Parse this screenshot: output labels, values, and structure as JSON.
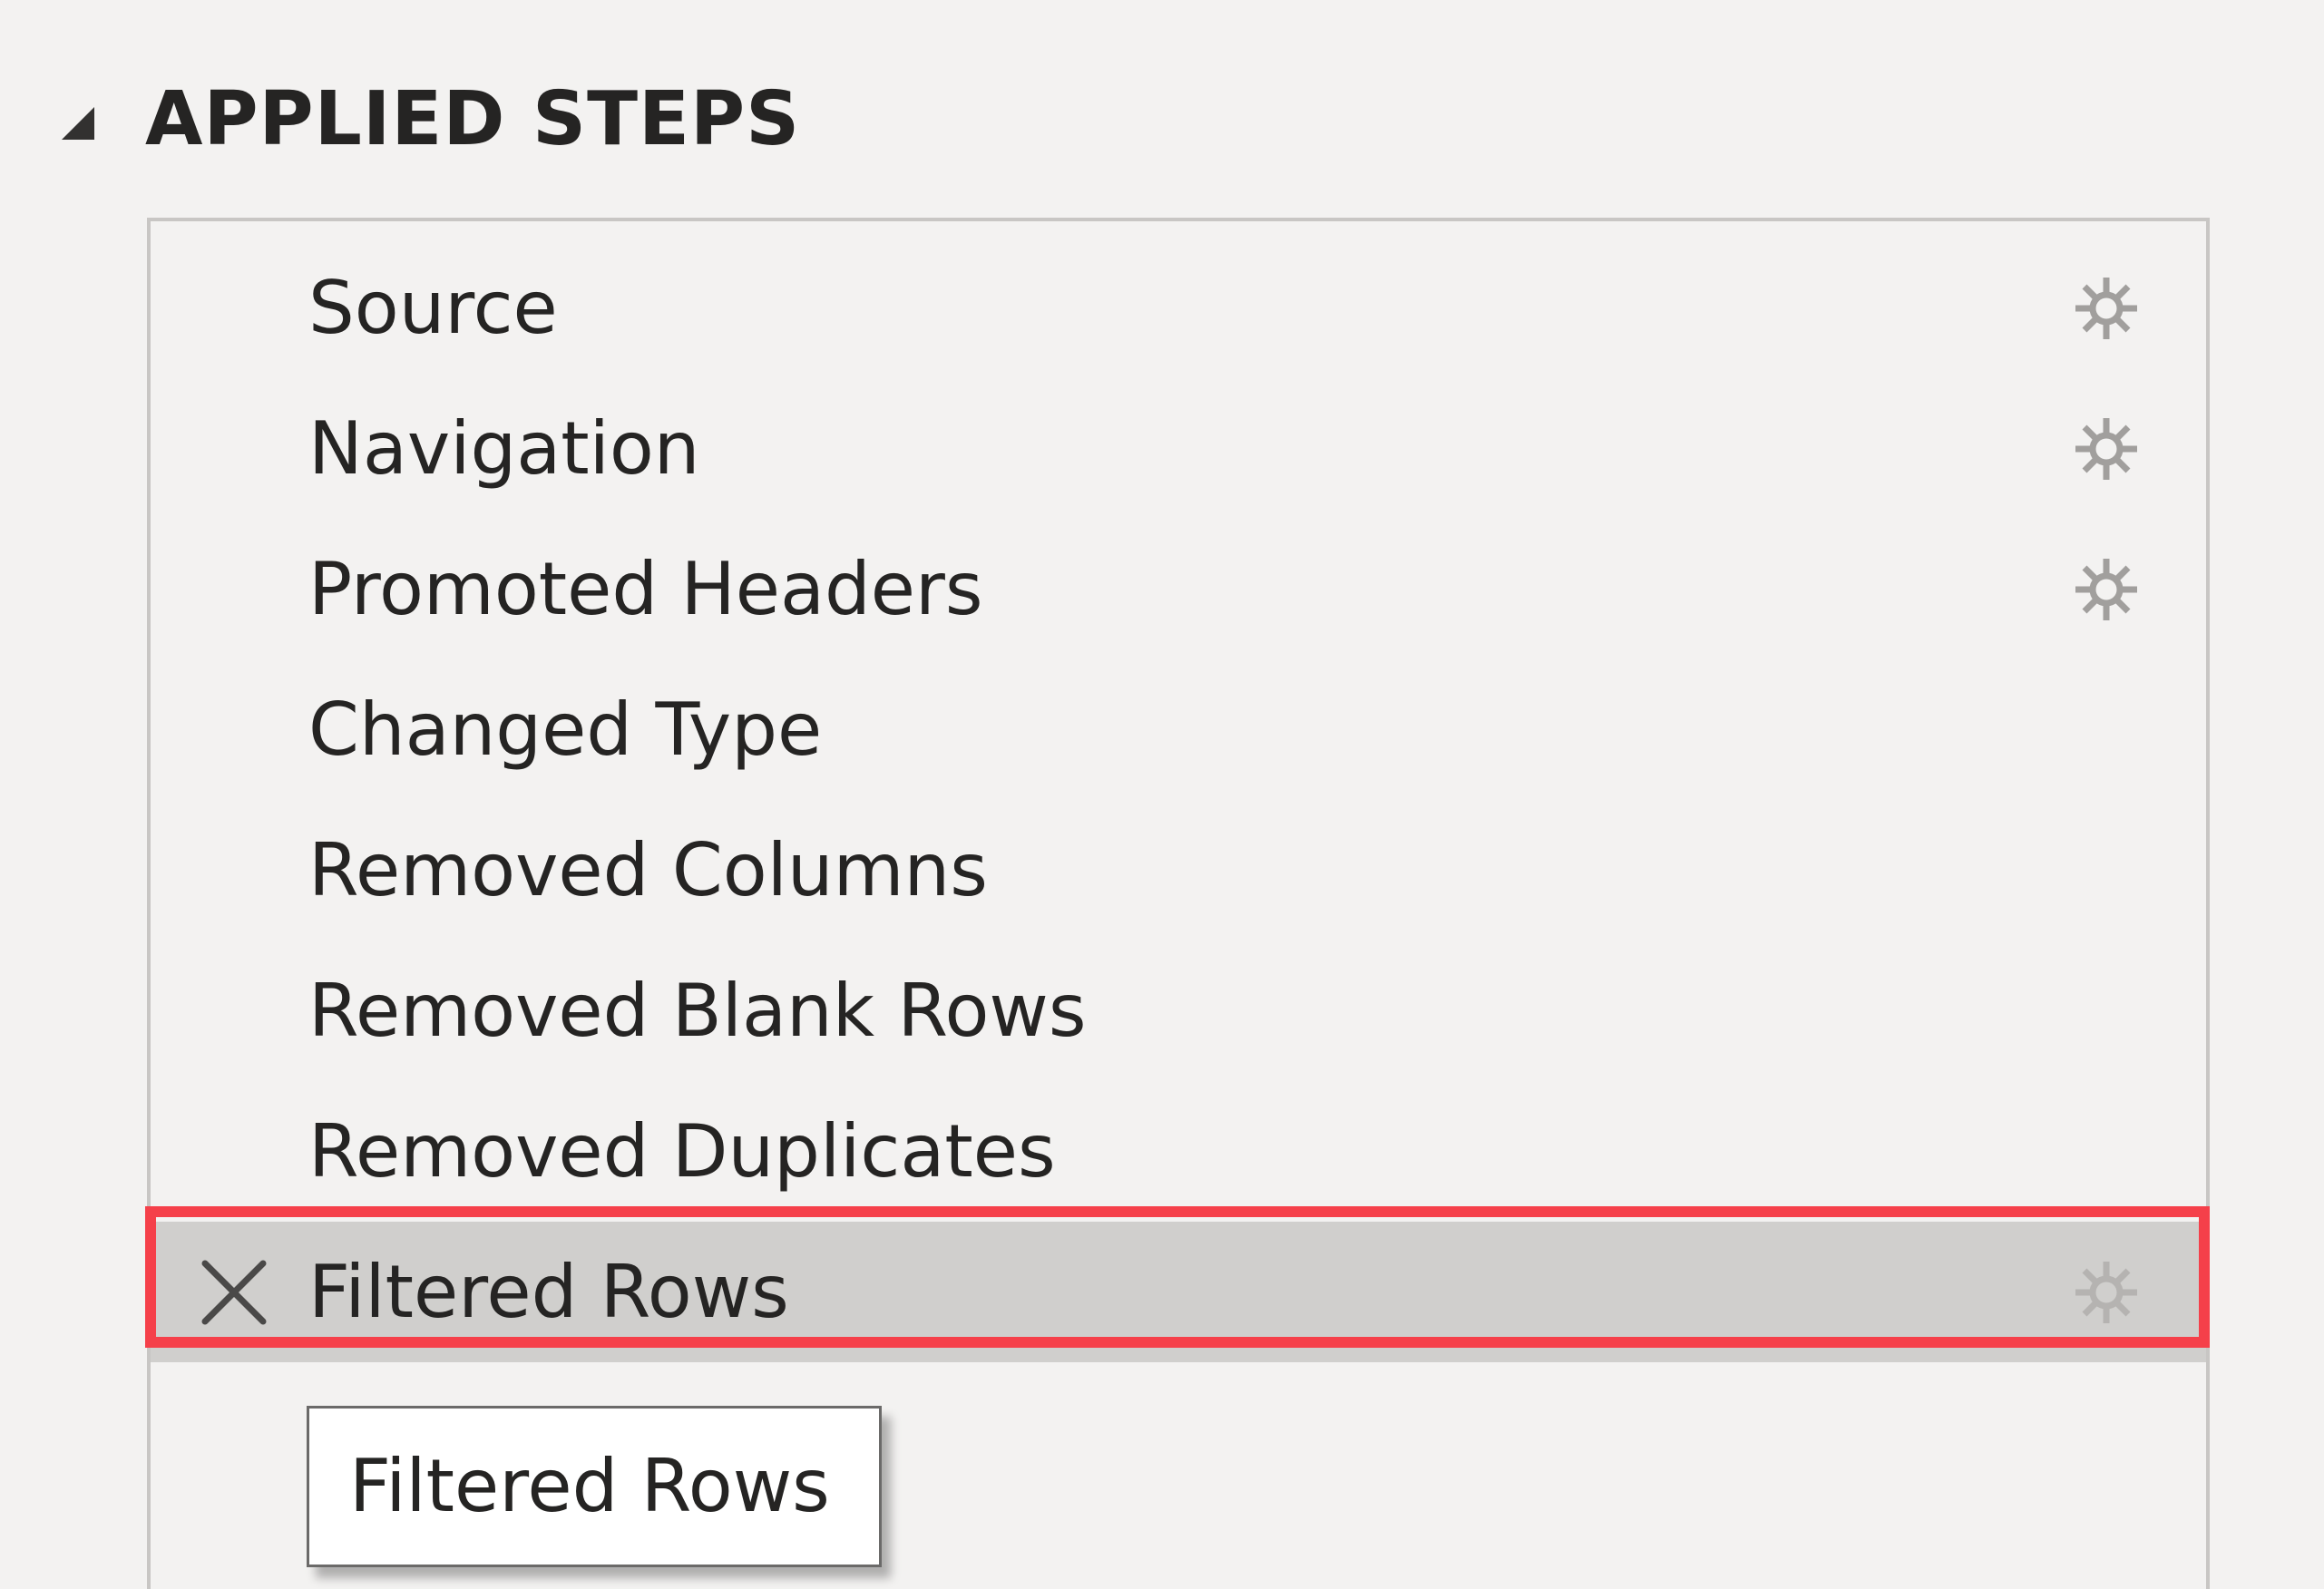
{
  "section": {
    "title": "APPLIED STEPS",
    "collapse_icon": "triangle-collapse-icon"
  },
  "steps": [
    {
      "label": "Source",
      "has_settings": true,
      "selected": false
    },
    {
      "label": "Navigation",
      "has_settings": true,
      "selected": false
    },
    {
      "label": "Promoted Headers",
      "has_settings": true,
      "selected": false
    },
    {
      "label": "Changed Type",
      "has_settings": false,
      "selected": false
    },
    {
      "label": "Removed Columns",
      "has_settings": false,
      "selected": false
    },
    {
      "label": "Removed Blank Rows",
      "has_settings": false,
      "selected": false
    },
    {
      "label": "Removed Duplicates",
      "has_settings": false,
      "selected": false
    },
    {
      "label": "Filtered Rows",
      "has_settings": true,
      "selected": true
    }
  ],
  "tooltip": {
    "text": "Filtered Rows"
  },
  "colors": {
    "panel_background": "#f3f2f1",
    "selected_row": "#d0cfcd",
    "highlight_border": "#f5404a",
    "gear_icon": "#a19f9d"
  }
}
